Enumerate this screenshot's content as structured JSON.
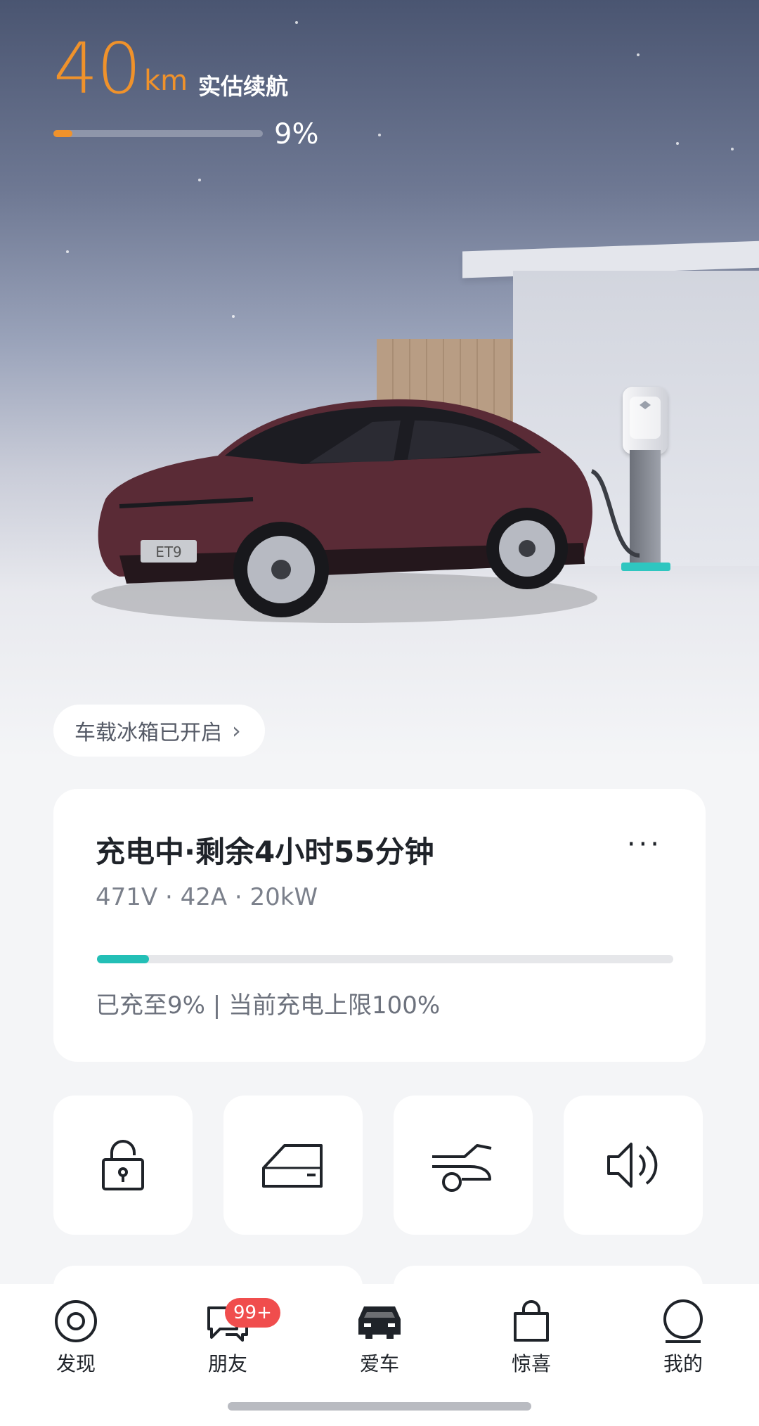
{
  "range": {
    "value": "40",
    "unit": "km",
    "label": "实估续航",
    "battery_percent_text": "9%",
    "battery_fraction": 0.09
  },
  "vehicle": {
    "plate_text": "ET9"
  },
  "fridge_chip": {
    "label": "车载冰箱已开启"
  },
  "charge_card": {
    "title": "充电中·剩余4小时55分钟",
    "more": "···",
    "specs": "471V · 42A · 20kW",
    "progress_fraction": 0.09,
    "limit_text": "已充至9% | 当前充电上限100%"
  },
  "controls": [
    {
      "icon": "lock-icon"
    },
    {
      "icon": "door-icon"
    },
    {
      "icon": "trunk-icon"
    },
    {
      "icon": "speaker-icon"
    }
  ],
  "nav": {
    "items": [
      {
        "label": "发现",
        "icon": "discover-icon"
      },
      {
        "label": "朋友",
        "icon": "chat-icon",
        "badge": "99+"
      },
      {
        "label": "爱车",
        "icon": "car-icon",
        "active": true
      },
      {
        "label": "惊喜",
        "icon": "shopping-bag-icon"
      },
      {
        "label": "我的",
        "icon": "profile-icon"
      }
    ]
  },
  "colors": {
    "accent_orange": "#f0922b",
    "accent_teal": "#23bfb6",
    "badge_red": "#f04d4d",
    "car_body": "#5a2b36"
  }
}
